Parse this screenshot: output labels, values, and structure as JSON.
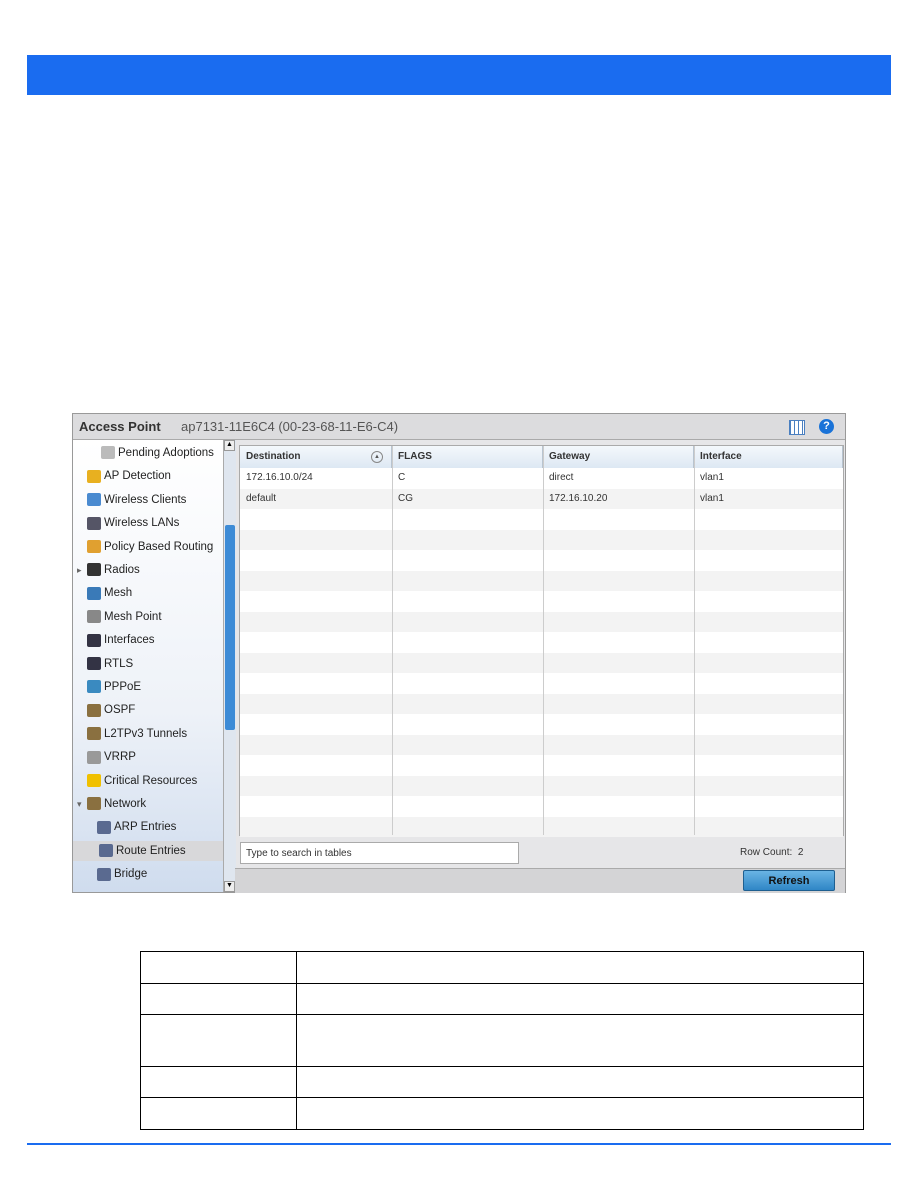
{
  "app": {
    "title": "Access Point",
    "device": "ap7131-11E6C4 (00-23-68-11-E6-C4)",
    "icons": [
      "table-icon",
      "help-icon"
    ]
  },
  "sidebar": {
    "items": [
      {
        "label": "Pending Adoptions",
        "icon": "adoption-icon"
      },
      {
        "label": "AP Detection",
        "icon": "ap-detection-icon"
      },
      {
        "label": "Wireless Clients",
        "icon": "client-icon"
      },
      {
        "label": "Wireless LANs",
        "icon": "wlan-icon"
      },
      {
        "label": "Policy Based Routing",
        "icon": "routing-icon"
      },
      {
        "label": "Radios",
        "icon": "radio-icon"
      },
      {
        "label": "Mesh",
        "icon": "mesh-icon"
      },
      {
        "label": "Mesh Point",
        "icon": "mesh-point-icon"
      },
      {
        "label": "Interfaces",
        "icon": "interface-icon"
      },
      {
        "label": "RTLS",
        "icon": "rtls-icon"
      },
      {
        "label": "PPPoE",
        "icon": "pppoe-icon"
      },
      {
        "label": "OSPF",
        "icon": "network-icon"
      },
      {
        "label": "L2TPv3 Tunnels",
        "icon": "network-icon"
      },
      {
        "label": "VRRP",
        "icon": "vrrp-icon"
      },
      {
        "label": "Critical Resources",
        "icon": "warning-icon"
      },
      {
        "label": "Network",
        "icon": "network-icon"
      },
      {
        "label": "ARP Entries",
        "icon": "ip-icon"
      },
      {
        "label": "Route Entries",
        "icon": "ip-icon",
        "selected": true
      },
      {
        "label": "Bridge",
        "icon": "bridge-icon"
      }
    ]
  },
  "table": {
    "columns": [
      "Destination",
      "FLAGS",
      "Gateway",
      "Interface"
    ],
    "rows": [
      [
        "172.16.10.0/24",
        "C",
        "direct",
        "vlan1"
      ],
      [
        "default",
        "CG",
        "172.16.10.20",
        "vlan1"
      ]
    ]
  },
  "search": {
    "placeholder": "Type to search in tables"
  },
  "row_count": {
    "label": "Row Count:",
    "value": "2"
  },
  "refresh_label": "Refresh",
  "colors": {
    "accent": "#1a6cf0"
  }
}
